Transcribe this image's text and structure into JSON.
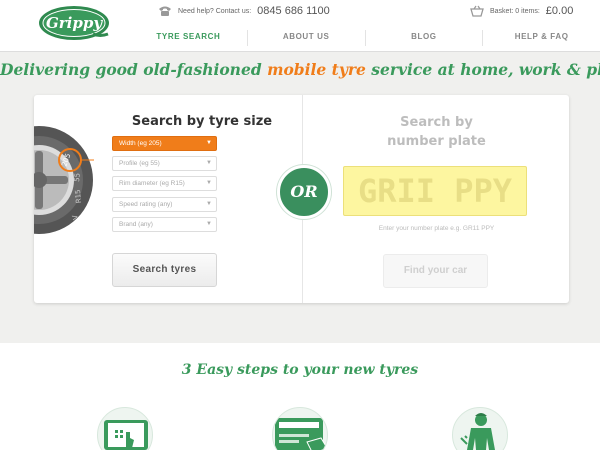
{
  "header": {
    "logo_text": "Grippy",
    "help_label": "Need help? Contact us:",
    "phone": "0845 686 1100",
    "basket_label": "Basket: 0 items:",
    "basket_amount": "£0.00"
  },
  "nav": [
    {
      "label": "TYRE SEARCH",
      "active": true
    },
    {
      "label": "ABOUT US",
      "active": false
    },
    {
      "label": "BLOG",
      "active": false
    },
    {
      "label": "HELP & FAQ",
      "active": false
    }
  ],
  "tagline": {
    "before": "Delivering good old-fashioned ",
    "highlight": "mobile tyre",
    "after": " service at home, work & play!"
  },
  "size_search": {
    "title": "Search by tyre size",
    "tyre_labels": [
      "205",
      "55",
      "R15",
      "V"
    ],
    "fields": [
      {
        "placeholder": "Width (eg 205)",
        "active": true
      },
      {
        "placeholder": "Profile (eg 55)",
        "active": false
      },
      {
        "placeholder": "Rim diameter (eg R15)",
        "active": false
      },
      {
        "placeholder": "Speed rating (any)",
        "active": false
      },
      {
        "placeholder": "Brand (any)",
        "active": false
      }
    ],
    "button": "Search tyres"
  },
  "or_label": "OR",
  "plate_search": {
    "title_line1": "Search by",
    "title_line2": "number plate",
    "plate_placeholder": "GRII PPY",
    "help": "Enter your number plate e.g. GR11 PPY",
    "button": "Find your car"
  },
  "steps": {
    "title": "3 Easy steps to your new tyres",
    "icons": [
      "tablet-touch-icon",
      "card-payment-icon",
      "mechanic-icon"
    ]
  },
  "colors": {
    "brand_green": "#3a9a5c",
    "accent_orange": "#f07d1a",
    "plate_yellow": "#fdf6a0"
  }
}
